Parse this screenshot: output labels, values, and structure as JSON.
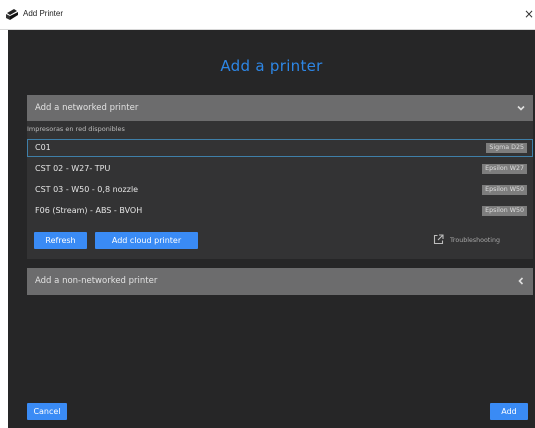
{
  "window": {
    "title": "Add Printer",
    "close_glyph": "×",
    "app_icon": "printer-app-icon"
  },
  "dialog": {
    "title": "Add a printer",
    "networked_section": {
      "label": "Add a networked printer",
      "expanded": true,
      "chevron": "chevron-down-icon"
    },
    "available_label": "Impresoras en red disponibles",
    "printers": [
      {
        "name": "C01",
        "model": "Sigma D25",
        "selected": true
      },
      {
        "name": "CST 02 - W27- TPU",
        "model": "Epsilon W27",
        "selected": false
      },
      {
        "name": "CST 03 - W50 - 0,8 nozzle",
        "model": "Epsilon W50",
        "selected": false
      },
      {
        "name": "F06 (Stream) - ABS - BVOH",
        "model": "Epsilon W50",
        "selected": false
      }
    ],
    "refresh_label": "Refresh",
    "add_cloud_label": "Add cloud printer",
    "troubleshooting_label": "Troubleshooting",
    "non_networked_section": {
      "label": "Add a non-networked printer",
      "expanded": false,
      "chevron": "chevron-left-icon"
    },
    "cancel_label": "Cancel",
    "add_label": "Add"
  },
  "colors": {
    "accent": "#3a8bf5",
    "title_blue": "#2d86e5",
    "dialog_bg": "#262627",
    "panel_bg": "#333334",
    "section_bg": "#6c6c6d",
    "selection_border": "#3f7fa8",
    "badge_bg": "#7d7d7d"
  }
}
